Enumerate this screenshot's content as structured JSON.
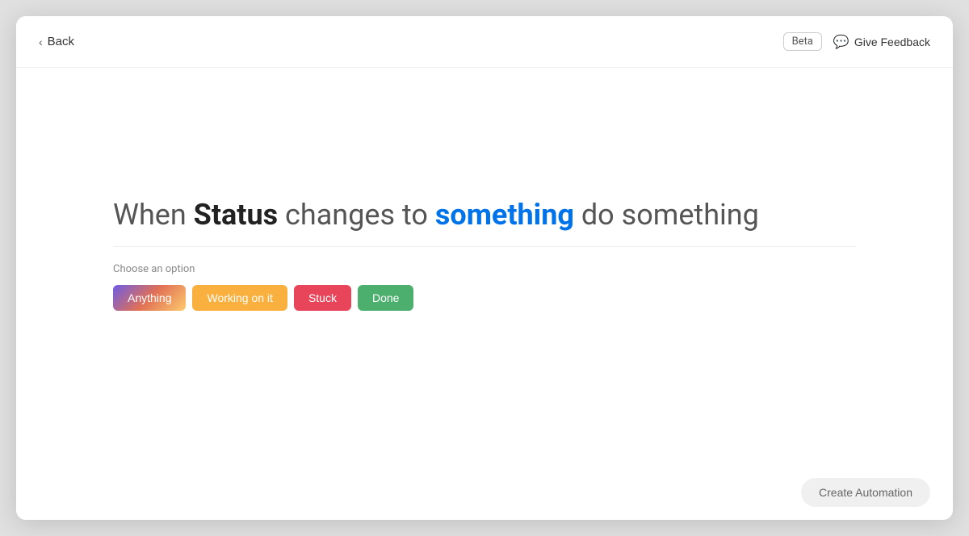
{
  "header": {
    "back_label": "Back",
    "beta_label": "Beta",
    "give_feedback_label": "Give Feedback"
  },
  "main": {
    "headline": {
      "prefix": "When ",
      "bold": "Status",
      "middle": " changes to ",
      "highlight": "something",
      "suffix": " do something"
    },
    "choose_label": "Choose an option",
    "options": [
      {
        "id": "anything",
        "label": "Anything",
        "style": "anything"
      },
      {
        "id": "working-on-it",
        "label": "Working on it",
        "style": "working"
      },
      {
        "id": "stuck",
        "label": "Stuck",
        "style": "stuck"
      },
      {
        "id": "done",
        "label": "Done",
        "style": "done"
      }
    ]
  },
  "footer": {
    "create_automation_label": "Create Automation"
  }
}
